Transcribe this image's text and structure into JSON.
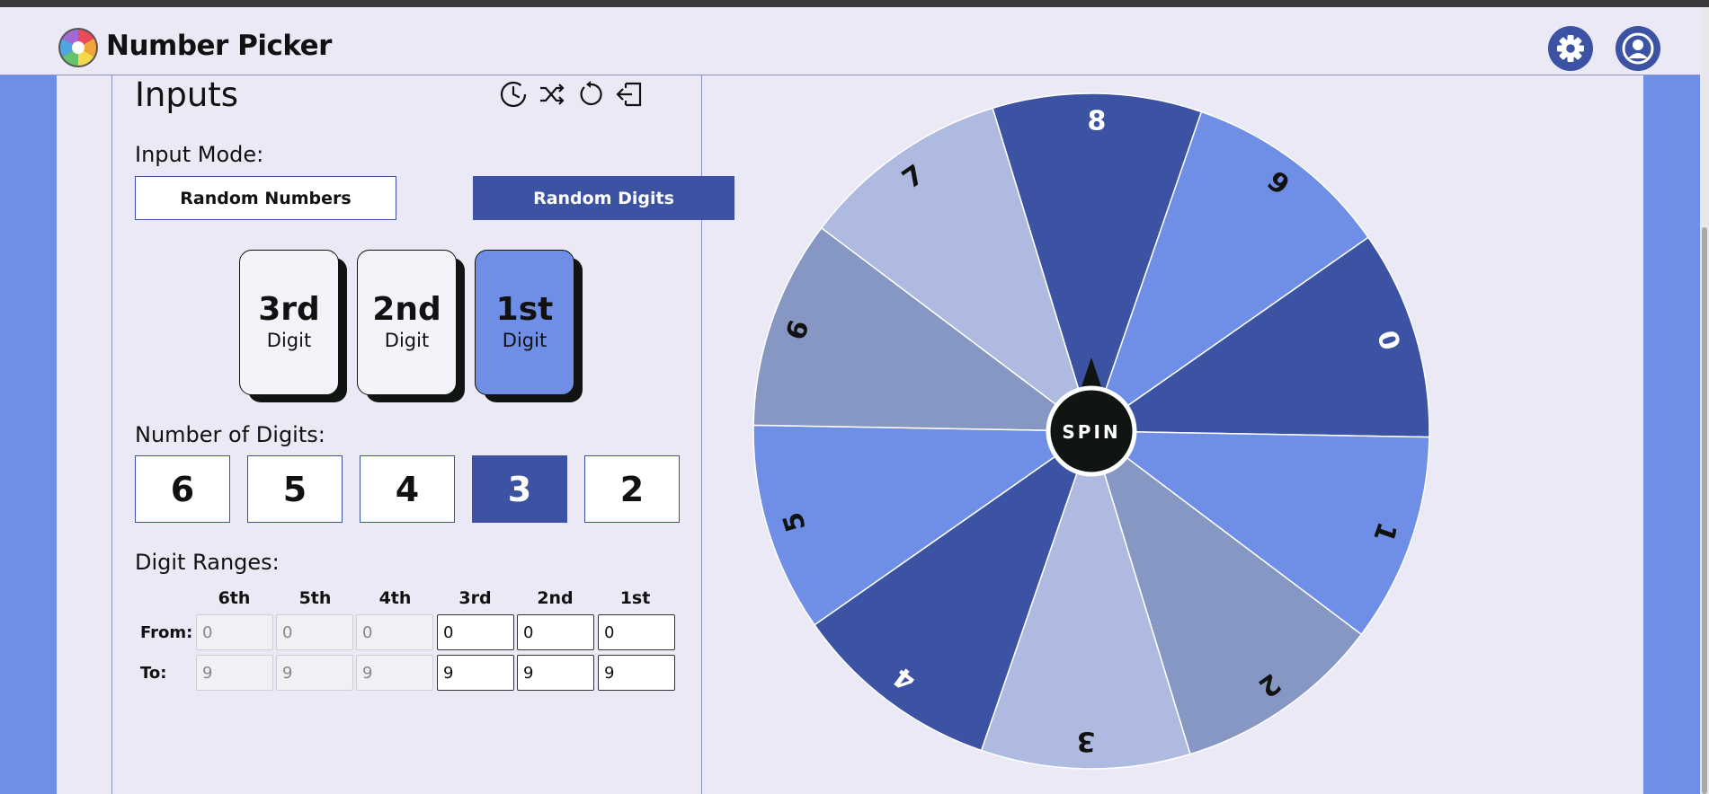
{
  "app": {
    "title": "Number Picker"
  },
  "header": {
    "settings_icon": "gear-icon",
    "account_icon": "user-circle-icon"
  },
  "inputs": {
    "title": "Inputs",
    "tools": [
      "history-icon",
      "shuffle-icon",
      "reset-icon",
      "import-icon"
    ],
    "input_mode_label": "Input Mode:",
    "modes": [
      {
        "label": "Random Numbers",
        "active": false
      },
      {
        "label": "Random Digits",
        "active": true
      }
    ],
    "digit_cards": [
      {
        "ordinal": "3rd",
        "word": "Digit",
        "active": false
      },
      {
        "ordinal": "2nd",
        "word": "Digit",
        "active": false
      },
      {
        "ordinal": "1st",
        "word": "Digit",
        "active": true
      }
    ],
    "num_digits_label": "Number of Digits:",
    "num_digits_options": [
      "6",
      "5",
      "4",
      "3",
      "2"
    ],
    "num_digits_selected": "3",
    "ranges_label": "Digit Ranges:",
    "ranges_columns": [
      "6th",
      "5th",
      "4th",
      "3rd",
      "2nd",
      "1st"
    ],
    "from_label": "From:",
    "to_label": "To:",
    "from_values": [
      "0",
      "0",
      "0",
      "0",
      "0",
      "0"
    ],
    "to_values": [
      "9",
      "9",
      "9",
      "9",
      "9",
      "9"
    ],
    "enabled_columns": [
      false,
      false,
      false,
      true,
      true,
      true
    ]
  },
  "wheel": {
    "center_label": "SPIN",
    "segments": [
      "8",
      "9",
      "0",
      "1",
      "2",
      "3",
      "4",
      "5",
      "6",
      "7"
    ],
    "colors": [
      "#3c52a3",
      "#6f8fe6",
      "#3c52a3",
      "#6f8fe6",
      "#8797c4",
      "#aebadf",
      "#3c52a3",
      "#6f8fe6",
      "#8797c4",
      "#aebadf"
    ],
    "hub_color": "#111511"
  },
  "colors": {
    "accent": "#3c52a3",
    "light_accent": "#6f8fe6",
    "panel_bg": "#ece9f6"
  }
}
